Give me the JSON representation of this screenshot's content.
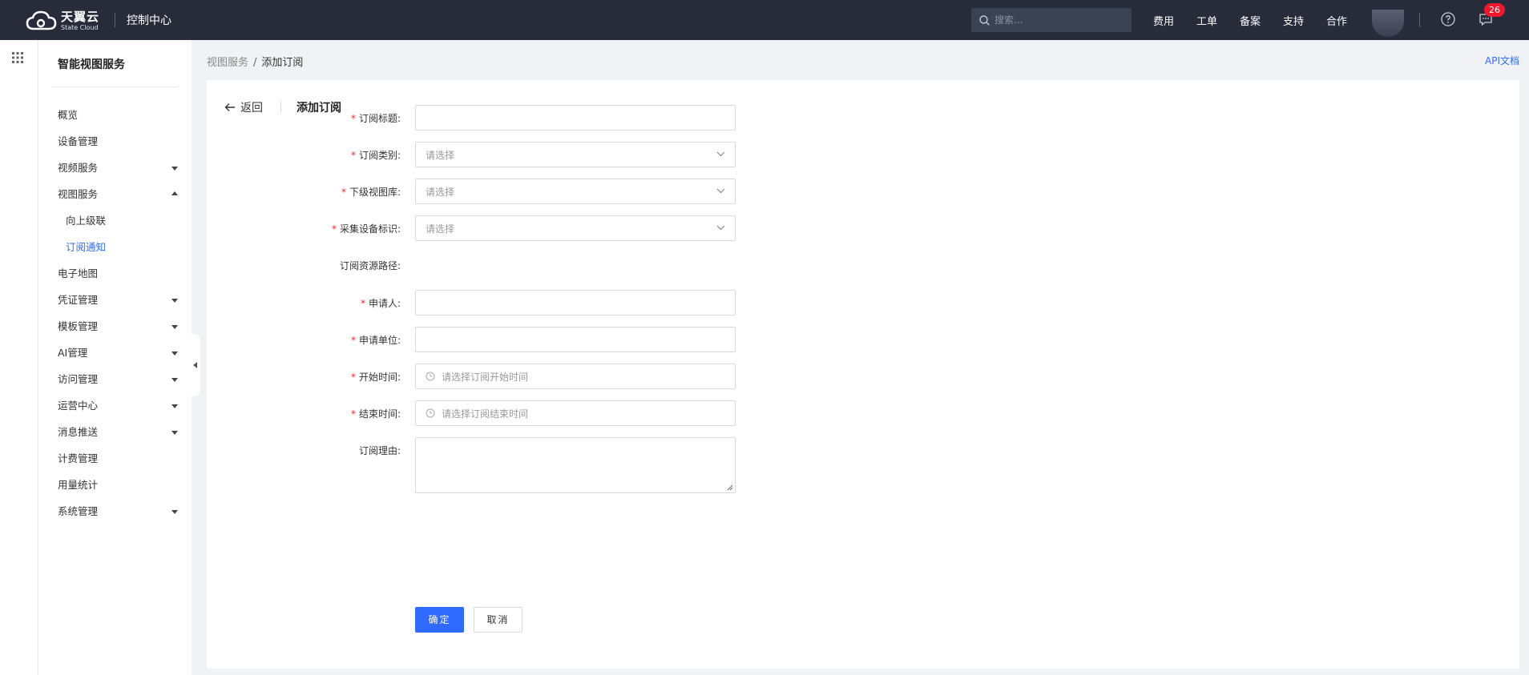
{
  "header": {
    "logo_cn": "天翼云",
    "logo_en": "State Cloud",
    "console_title": "控制中心",
    "search_placeholder": "搜索...",
    "nav": [
      "费用",
      "工单",
      "备案",
      "支持",
      "合作"
    ],
    "message_count": "26"
  },
  "sidebar": {
    "title": "智能视图服务",
    "items": [
      {
        "label": "概览",
        "caret": "none"
      },
      {
        "label": "设备管理",
        "caret": "none"
      },
      {
        "label": "视频服务",
        "caret": "down"
      },
      {
        "label": "视图服务",
        "caret": "up"
      },
      {
        "label": "向上级联",
        "caret": "none",
        "sub": true
      },
      {
        "label": "订阅通知",
        "caret": "none",
        "sub": true,
        "active": true
      },
      {
        "label": "电子地图",
        "caret": "none"
      },
      {
        "label": "凭证管理",
        "caret": "down"
      },
      {
        "label": "模板管理",
        "caret": "down"
      },
      {
        "label": "AI管理",
        "caret": "down"
      },
      {
        "label": "访问管理",
        "caret": "down"
      },
      {
        "label": "运营中心",
        "caret": "down"
      },
      {
        "label": "消息推送",
        "caret": "down"
      },
      {
        "label": "计费管理",
        "caret": "none"
      },
      {
        "label": "用量统计",
        "caret": "none"
      },
      {
        "label": "系统管理",
        "caret": "down"
      }
    ]
  },
  "breadcrumb": {
    "parent": "视图服务",
    "separator": "/",
    "current": "添加订阅"
  },
  "api_doc_link": "API文档",
  "page": {
    "back_label": "返回",
    "title": "添加订阅"
  },
  "form": {
    "fields": [
      {
        "label": "订阅标题:",
        "required": true,
        "type": "text",
        "value": "",
        "placeholder": ""
      },
      {
        "label": "订阅类别:",
        "required": true,
        "type": "select",
        "placeholder": "请选择"
      },
      {
        "label": "下级视图库:",
        "required": true,
        "type": "select",
        "placeholder": "请选择"
      },
      {
        "label": "采集设备标识:",
        "required": true,
        "type": "select",
        "placeholder": "请选择"
      },
      {
        "label": "订阅资源路径:",
        "required": false,
        "type": "static",
        "value": ""
      },
      {
        "label": "申请人:",
        "required": true,
        "type": "text",
        "value": "",
        "placeholder": ""
      },
      {
        "label": "申请单位:",
        "required": true,
        "type": "text",
        "value": "",
        "placeholder": ""
      },
      {
        "label": "开始时间:",
        "required": true,
        "type": "datetime",
        "placeholder": "请选择订阅开始时间"
      },
      {
        "label": "结束时间:",
        "required": true,
        "type": "datetime",
        "placeholder": "请选择订阅结束时间"
      },
      {
        "label": "订阅理由:",
        "required": false,
        "type": "textarea",
        "value": ""
      }
    ],
    "submit_label": "确定",
    "cancel_label": "取消"
  },
  "colors": {
    "topbar": "#262c3a",
    "accent": "#2f6bff",
    "required": "#f5222d",
    "badge": "#f0182c"
  }
}
